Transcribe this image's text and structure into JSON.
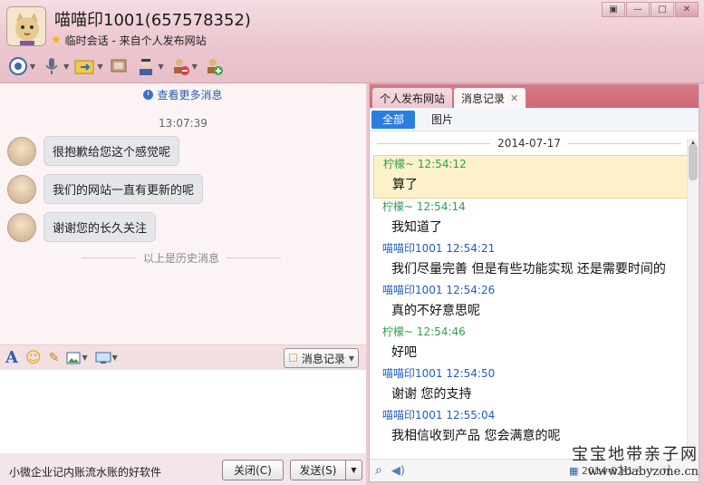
{
  "window": {
    "title": "喵喵印1001(657578352)",
    "subtitle": "临时会话 - 来自个人发布网站",
    "controls": [
      "▣",
      "—",
      "□",
      "✕"
    ]
  },
  "toolbar": {
    "icons": [
      "camera-icon",
      "microphone-icon",
      "file-transfer-icon",
      "remote-desktop-icon",
      "contact-card-icon",
      "block-user-icon",
      "add-friend-icon"
    ]
  },
  "left": {
    "more_history": "查看更多消息",
    "time": "13:07:39",
    "messages": [
      "很抱歉给您这个感觉呢",
      "我们的网站一直有更新的呢",
      "谢谢您的长久关注"
    ],
    "history_divider": "以上是历史消息",
    "history_button": "消息记录",
    "promo": "小微企业记内账流水账的好软件",
    "close_button": "关闭(C)",
    "send_button": "发送(S)"
  },
  "right": {
    "tabs": [
      "个人发布网站",
      "消息记录"
    ],
    "filters": [
      "全部",
      "图片"
    ],
    "date": "2014-07-17",
    "entries": [
      {
        "who": "柠檬~ 12:54:12",
        "color": "green",
        "text": "算了",
        "highlight": true
      },
      {
        "who": "柠檬~ 12:54:14",
        "color": "green",
        "text": "我知道了"
      },
      {
        "who": "喵喵印1001 12:54:21",
        "color": "blue",
        "text": "我们尽量完善 但是有些功能实现 还是需要时间的"
      },
      {
        "who": "喵喵印1001 12:54:26",
        "color": "blue",
        "text": "真的不好意思呢"
      },
      {
        "who": "柠檬~ 12:54:46",
        "color": "green",
        "text": "好吧"
      },
      {
        "who": "喵喵印1001 12:54:50",
        "color": "blue",
        "text": "谢谢 您的支持"
      },
      {
        "who": "喵喵印1001 12:55:04",
        "color": "blue",
        "text": "我相信收到产品 您会满意的呢"
      }
    ],
    "bottom_date": "2014-07-1",
    "nav": [
      "|‹",
      "‹",
      "›",
      "›|"
    ]
  },
  "watermark": {
    "line1": "宝宝地带亲子网",
    "line2": "www.ibabyzone.cn"
  },
  "colors": {
    "accent": "#2b7ee0",
    "green_name": "#2f9e4f",
    "blue_name": "#1f5fbf",
    "tab_bar": "#d97a86"
  }
}
